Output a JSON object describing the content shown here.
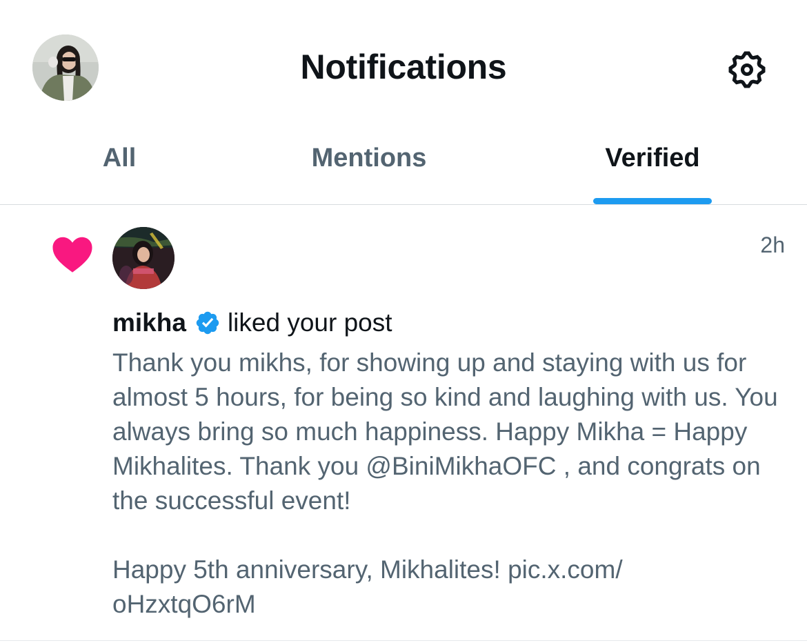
{
  "header": {
    "title": "Notifications",
    "avatar_icon": "user-avatar",
    "settings_icon": "gear-icon"
  },
  "tabs": [
    {
      "label": "All",
      "active": false
    },
    {
      "label": "Mentions",
      "active": false
    },
    {
      "label": "Verified",
      "active": true
    }
  ],
  "notification": {
    "type_icon": "heart-icon",
    "username": "mikha",
    "action": "liked your post",
    "time": "2h",
    "post_text": "Thank you mikhs, for showing up and staying with us for almost 5 hours, for being so kind and laughing with us. You always bring so much happiness. Happy Mikha = Happy Mikhalites. Thank you @BiniMikhaOFC , and congrats on the successful event!\n\nHappy 5th anniversary, Mikhalites! pic.x.com/\noHzxtqO6rM"
  },
  "colors": {
    "accent": "#1d9bf0",
    "heart": "#f91880",
    "primary_text": "#0f1419",
    "secondary_text": "#536471",
    "divider": "#d7dbdf"
  }
}
